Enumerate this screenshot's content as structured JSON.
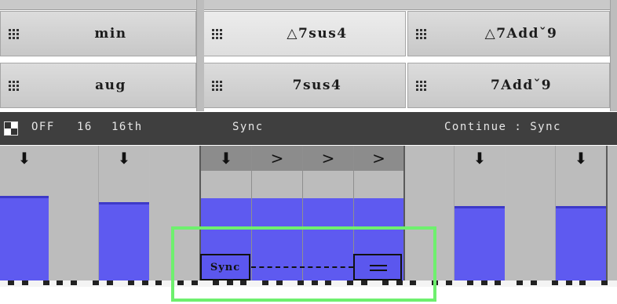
{
  "chords": [
    {
      "label": "min"
    },
    {
      "label": "△7sus4"
    },
    {
      "label": "△7Addˇ9"
    },
    {
      "label": "aug"
    },
    {
      "label": "7sus4"
    },
    {
      "label": "7Addˇ9"
    }
  ],
  "transport": {
    "state": "OFF",
    "steps": "16",
    "rate": "16th",
    "sync": "Sync",
    "continue": "Continue : Sync"
  },
  "step_symbols": {
    "down": "⬇",
    "tie": ">"
  },
  "step_levels": [
    0.75,
    0,
    0.69,
    0,
    0.75,
    0.75,
    0.75,
    0.75,
    0,
    0.66,
    0,
    0.66
  ],
  "sync_box": {
    "label": "Sync"
  },
  "tie_box": {
    "label": ""
  },
  "colors": {
    "step_fill": "#5e5af0",
    "highlight": "#6ef06e",
    "transport_bg": "#3f3f3f"
  }
}
